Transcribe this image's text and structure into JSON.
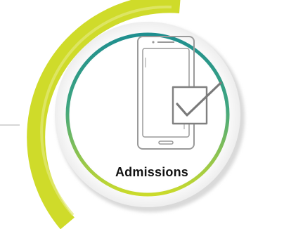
{
  "tile": {
    "label": "Admissions",
    "icon": "phone-checkbox-icon"
  },
  "colors": {
    "outer_arc": "#cfdb2a",
    "ring_gradient_top": "#1f8f8f",
    "ring_gradient_mid": "#4fb07a",
    "ring_gradient_bottom": "#c9d92c",
    "icon_stroke": "#9a9a9a",
    "checkbox_stroke": "#808080",
    "text": "#111111"
  }
}
